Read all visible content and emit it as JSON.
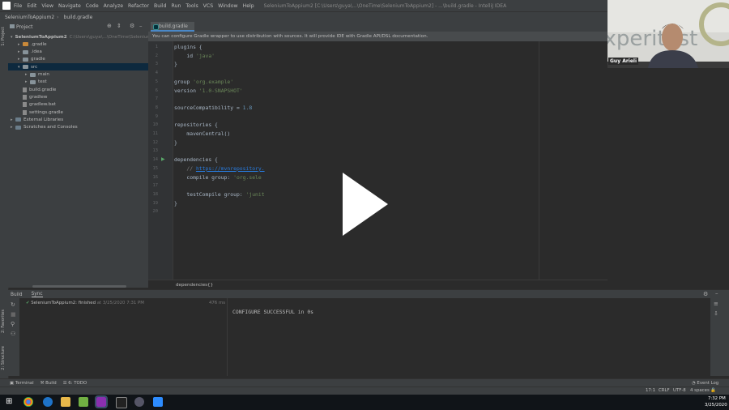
{
  "app": {
    "menu": [
      "File",
      "Edit",
      "View",
      "Navigate",
      "Code",
      "Analyze",
      "Refactor",
      "Build",
      "Run",
      "Tools",
      "VCS",
      "Window",
      "Help"
    ],
    "window_title": "SeleniumToAppium2 [C:\\Users\\guya\\...\\OneTime\\SeleniumToAppium2] - ...\\build.gradle - IntelliJ IDEA"
  },
  "navbar": {
    "project": "SeleniumToAppium2",
    "file": "build.gradle"
  },
  "sidebar": {
    "project_tab": "1: Project",
    "structure_tab": "2: Structure",
    "favorites_tab": "2: Favorites"
  },
  "project_panel": {
    "title": "Project",
    "items": [
      {
        "label": "SeleniumToAppium2",
        "suffix": "C:\\Users\\guya\\...\\OneTime\\SeleniumT...",
        "depth": 0,
        "type": "folder"
      },
      {
        "label": ".gradle",
        "depth": 1,
        "type": "folder-orange"
      },
      {
        "label": ".idea",
        "depth": 1,
        "type": "folder"
      },
      {
        "label": "gradle",
        "depth": 1,
        "type": "folder"
      },
      {
        "label": "src",
        "depth": 1,
        "type": "folder",
        "selected": true
      },
      {
        "label": "main",
        "depth": 2,
        "type": "folder"
      },
      {
        "label": "test",
        "depth": 2,
        "type": "folder"
      },
      {
        "label": "build.gradle",
        "depth": 1,
        "type": "file"
      },
      {
        "label": "gradlew",
        "depth": 1,
        "type": "file"
      },
      {
        "label": "gradlew.bat",
        "depth": 1,
        "type": "file"
      },
      {
        "label": "settings.gradle",
        "depth": 1,
        "type": "file"
      },
      {
        "label": "External Libraries",
        "depth": 0,
        "type": "lib"
      },
      {
        "label": "Scratches and Consoles",
        "depth": 0,
        "type": "scratch"
      }
    ]
  },
  "editor": {
    "tab": "build.gradle",
    "banner": "You can configure Gradle wrapper to use distribution with sources. It will provide IDE with Gradle API/DSL documentation.",
    "breadcrumb": "dependencies{}",
    "line_numbers": [
      "1",
      "2",
      "3",
      "4",
      "5",
      "6",
      "7",
      "8",
      "9",
      "10",
      "11",
      "12",
      "13",
      "14",
      "15",
      "16",
      "17",
      "18",
      "19",
      "20"
    ],
    "lines": [
      {
        "n": 1,
        "parts": [
          [
            "kw",
            "plugins {"
          ]
        ]
      },
      {
        "n": 2,
        "parts": [
          [
            "kw",
            "    id "
          ],
          [
            "str",
            "'java'"
          ]
        ]
      },
      {
        "n": 3,
        "parts": [
          [
            "kw",
            "}"
          ]
        ]
      },
      {
        "n": 4,
        "parts": []
      },
      {
        "n": 5,
        "parts": [
          [
            "kw",
            "group "
          ],
          [
            "str",
            "'org.example'"
          ]
        ]
      },
      {
        "n": 6,
        "parts": [
          [
            "kw",
            "version "
          ],
          [
            "str",
            "'1.0-SNAPSHOT'"
          ]
        ]
      },
      {
        "n": 7,
        "parts": []
      },
      {
        "n": 8,
        "parts": [
          [
            "kw",
            "sourceCompatibility = "
          ],
          [
            "num",
            "1.8"
          ]
        ]
      },
      {
        "n": 9,
        "parts": []
      },
      {
        "n": 10,
        "parts": [
          [
            "kw",
            "repositories {"
          ]
        ]
      },
      {
        "n": 11,
        "parts": [
          [
            "kw",
            "    mavenCentral()"
          ]
        ]
      },
      {
        "n": 12,
        "parts": [
          [
            "kw",
            "}"
          ]
        ]
      },
      {
        "n": 13,
        "parts": []
      },
      {
        "n": 14,
        "parts": [
          [
            "kw",
            "dependencies {"
          ]
        ]
      },
      {
        "n": 15,
        "parts": [
          [
            "cm",
            "    // "
          ],
          [
            "lk",
            "https://mvnrepository."
          ]
        ]
      },
      {
        "n": 16,
        "parts": [
          [
            "kw",
            "    compile group: "
          ],
          [
            "str",
            "'org.sele"
          ]
        ]
      },
      {
        "n": 17,
        "parts": []
      },
      {
        "n": 18,
        "parts": [
          [
            "kw",
            "    testCompile group: "
          ],
          [
            "str",
            "'junit"
          ]
        ]
      },
      {
        "n": 19,
        "parts": [
          [
            "kw",
            "}"
          ]
        ]
      },
      {
        "n": 20,
        "parts": []
      }
    ]
  },
  "webcam": {
    "name": "Guy Arieli",
    "backdrop_text": "experitest"
  },
  "build_panel": {
    "tabs": [
      "Build",
      "Sync"
    ],
    "tree_item": "SeleniumToAppium2: finished",
    "tree_time": "at 3/25/2020 7:31 PM",
    "duration": "476 ms",
    "output": "CONFIGURE SUCCESSFUL in 0s"
  },
  "toolbar": {
    "terminal": "Terminal",
    "build": "Build",
    "todo": "6: TODO",
    "event_log": "Event Log"
  },
  "status": {
    "pos": "17:1",
    "line_sep": "CRLF",
    "encoding": "UTF-8",
    "indent": "4 spaces"
  },
  "taskbar": {
    "time": "7:32 PM",
    "date": "3/25/2020"
  },
  "colors": {
    "accent": "#4a88c7",
    "background": "#2b2b2b",
    "panel": "#3c3f41",
    "string": "#6a8759"
  }
}
